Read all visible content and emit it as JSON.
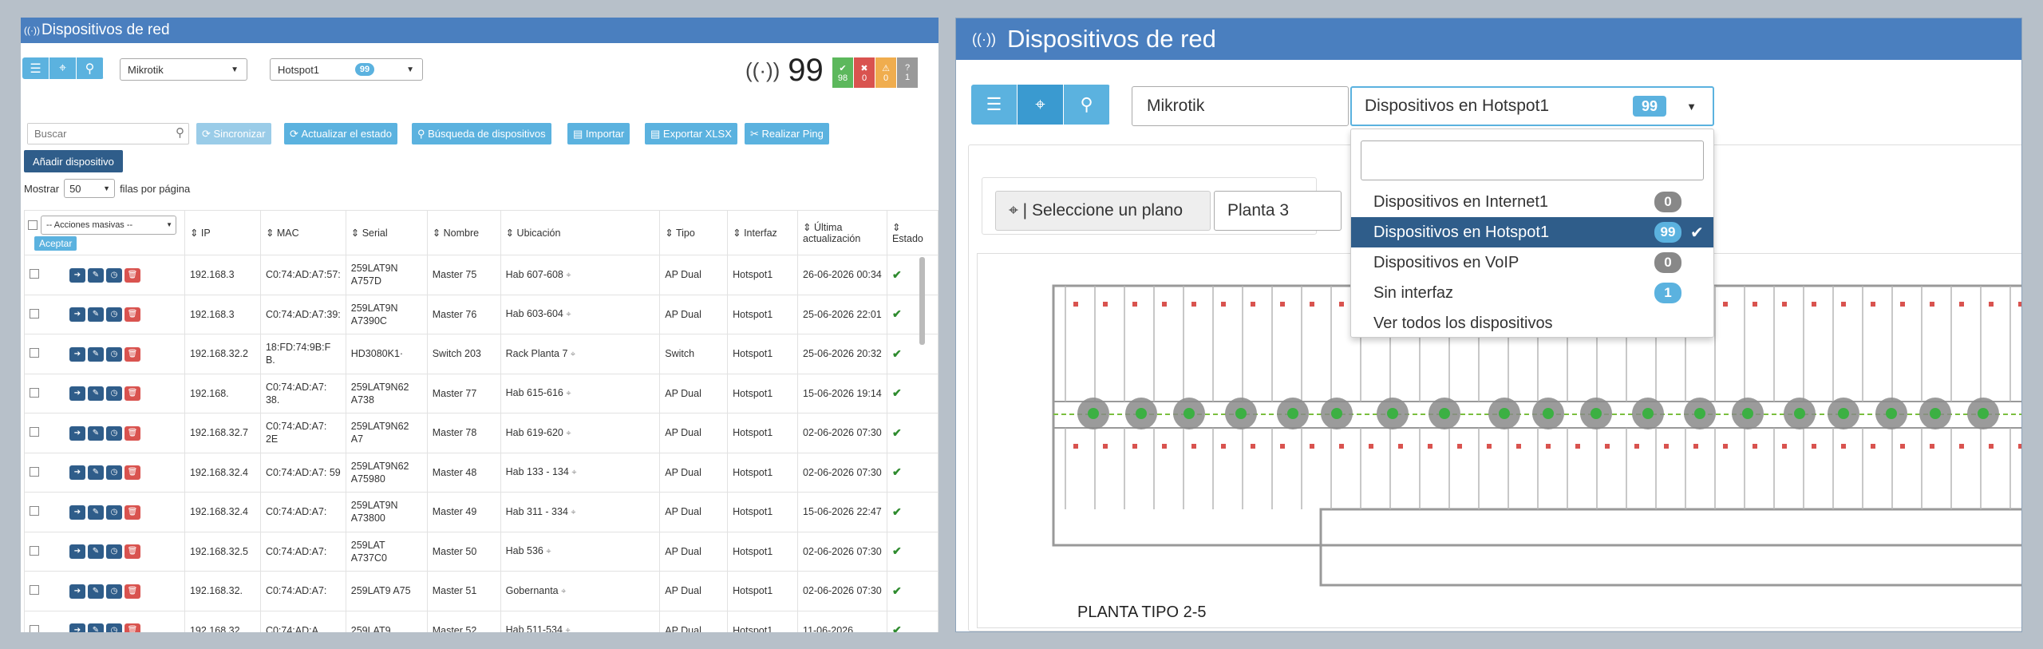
{
  "left": {
    "title": "Dispositivos de red",
    "brand_select": "Mikrotik",
    "iface_select": "Hotspot1",
    "iface_count": "99",
    "total": "99",
    "status": [
      {
        "icon": "✔",
        "count": "98",
        "color": "#5cb85c"
      },
      {
        "icon": "✖",
        "count": "0",
        "color": "#d9534f"
      },
      {
        "icon": "⚠",
        "count": "0",
        "color": "#f0ad4e"
      },
      {
        "icon": "?",
        "count": "1",
        "color": "#999999"
      }
    ],
    "search_placeholder": "Buscar",
    "buttons": [
      "Sincronizar",
      "Actualizar el estado",
      "Búsqueda de dispositivos",
      "Importar",
      "Exportar XLSX",
      "Realizar Ping"
    ],
    "add_label": "Añadir dispositivo",
    "show_label": "Mostrar",
    "per_page": "50",
    "per_page_label": "filas por página",
    "bulk_select": "-- Acciones masivas --",
    "accept": "Aceptar",
    "columns": [
      "IP",
      "MAC",
      "Serial",
      "Nombre",
      "Ubicación",
      "Tipo",
      "Interfaz",
      "Última actualización",
      "Estado"
    ],
    "rows": [
      {
        "ip": "192.168.3",
        "mac": "C0:74:AD:A7:57:",
        "serial": "259LAT9N A757D",
        "nombre": "Master 75",
        "ubic": "Hab 607-608",
        "tipo": "AP Dual",
        "iface": "Hotspot1",
        "fecha": "26-06-2026 00:34"
      },
      {
        "ip": "192.168.3",
        "mac": "C0:74:AD:A7:39:",
        "serial": "259LAT9N A7390C",
        "nombre": "Master 76",
        "ubic": "Hab 603-604",
        "tipo": "AP Dual",
        "iface": "Hotspot1",
        "fecha": "25-06-2026 22:01"
      },
      {
        "ip": "192.168.32.2",
        "mac": "18:FD:74:9B:F B.",
        "serial": "HD3080K1·",
        "nombre": "Switch 203",
        "ubic": "Rack Planta 7",
        "tipo": "Switch",
        "iface": "Hotspot1",
        "fecha": "25-06-2026 20:32"
      },
      {
        "ip": "192.168.",
        "mac": "C0:74:AD:A7: 38.",
        "serial": "259LAT9N62 A738",
        "nombre": "Master 77",
        "ubic": "Hab 615-616",
        "tipo": "AP Dual",
        "iface": "Hotspot1",
        "fecha": "15-06-2026 19:14"
      },
      {
        "ip": "192.168.32.7",
        "mac": "C0:74:AD:A7: 2E",
        "serial": "259LAT9N62 A7",
        "nombre": "Master 78",
        "ubic": "Hab 619-620",
        "tipo": "AP Dual",
        "iface": "Hotspot1",
        "fecha": "02-06-2026 07:30"
      },
      {
        "ip": "192.168.32.4",
        "mac": "C0:74:AD:A7: 59",
        "serial": "259LAT9N62 A75980",
        "nombre": "Master 48",
        "ubic": "Hab 133 - 134",
        "tipo": "AP Dual",
        "iface": "Hotspot1",
        "fecha": "02-06-2026 07:30"
      },
      {
        "ip": "192.168.32.4",
        "mac": "C0:74:AD:A7:",
        "serial": "259LAT9N A73800",
        "nombre": "Master 49",
        "ubic": "Hab 311 - 334",
        "tipo": "AP Dual",
        "iface": "Hotspot1",
        "fecha": "15-06-2026 22:47"
      },
      {
        "ip": "192.168.32.5",
        "mac": "C0:74:AD:A7:",
        "serial": "259LAT A737C0",
        "nombre": "Master 50",
        "ubic": "Hab 536",
        "tipo": "AP Dual",
        "iface": "Hotspot1",
        "fecha": "02-06-2026 07:30"
      },
      {
        "ip": "192.168.32.",
        "mac": "C0:74:AD:A7:",
        "serial": "259LAT9 A75",
        "nombre": "Master 51",
        "ubic": "Gobernanta",
        "tipo": "AP Dual",
        "iface": "Hotspot1",
        "fecha": "02-06-2026 07:30"
      },
      {
        "ip": "192.168.32.",
        "mac": "C0:74:AD:A",
        "serial": "259LAT9",
        "nombre": "Master 52",
        "ubic": "Hab 511-534",
        "tipo": "AP Dual",
        "iface": "Hotspot1",
        "fecha": "11-06-2026"
      }
    ]
  },
  "right": {
    "title": "Dispositivos de red",
    "brand_select": "Mikrotik",
    "iface_select": "Dispositivos en Hotspot1",
    "iface_count": "99",
    "plan_label": "| Seleccione un plano",
    "floor": "Planta 3",
    "options": [
      {
        "label": "Dispositivos en Internet1",
        "count": "0",
        "color": "#888888"
      },
      {
        "label": "Dispositivos en Hotspot1",
        "count": "99",
        "color": "#5bb2df"
      },
      {
        "label": "Dispositivos en VoIP",
        "count": "0",
        "color": "#888888"
      },
      {
        "label": "Sin interfaz",
        "count": "1",
        "color": "#5bb2df"
      },
      {
        "label": "Ver todos los dispositivos",
        "count": "",
        "color": ""
      }
    ],
    "floorplan_label": "PLANTA TIPO 2-5"
  },
  "colors": {
    "header": "#4a7fbf",
    "accent": "#5bb2df",
    "dark_button": "#2f5d8a",
    "danger": "#d9534f",
    "success": "#2e8b2e"
  }
}
